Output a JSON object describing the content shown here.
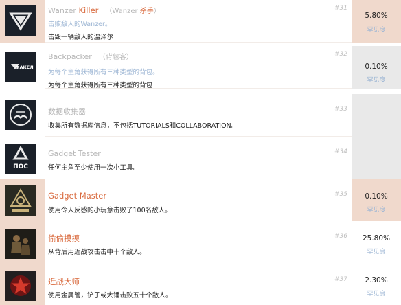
{
  "achievements": [
    {
      "title_en_prefix": "Wanzer ",
      "title_en_highlight": "Killer",
      "subtitle_prefix": "（Wanzer ",
      "subtitle_highlight": "杀手",
      "subtitle_suffix": "）",
      "hint": "击败敌人的Wanzer。",
      "description": "击毁一辆敌人的温泽尔",
      "number": "#31",
      "percent": "5.80%",
      "rarity": "罕见度",
      "icon": "triangle-emblem-icon"
    },
    {
      "title": "Backpacker",
      "subtitle": "（背包客）",
      "hint": "为每个主角获得所有三种类型的背包。",
      "description": "为每个主角获得所有三种类型的背包",
      "number": "#32",
      "percent": "0.10%",
      "rarity": "罕见度",
      "icon": "fakel-logo-icon",
      "icon_text": "ФАКЕЛ"
    },
    {
      "title": "数据收集器",
      "description": "收集所有数据库信息，不包括TUTORIALS和COLLABORATION。",
      "number": "#33",
      "icon": "book-emblem-icon"
    },
    {
      "title": "Gadget Tester",
      "description": "任何主角至少使用一次小工具。",
      "number": "#34",
      "icon": "noc-logo-icon",
      "icon_text": "ПОС"
    },
    {
      "title": "Gadget Master",
      "description": "使用令人反感的小玩意击败了100名敌人。",
      "number": "#35",
      "percent": "0.10%",
      "rarity": "罕见度",
      "icon": "hex-emblem-icon"
    },
    {
      "title": "偷偷摸摸",
      "description": "从背后用近战攻击击中十个敌人。",
      "number": "#36",
      "percent": "25.80%",
      "rarity": "罕见度",
      "icon": "soldier-icon"
    },
    {
      "title": "近战大师",
      "description": "使用金属管，铲子或大锤击败五十个敌人。",
      "number": "#37",
      "percent": "2.30%",
      "rarity": "罕见度",
      "icon": "red-star-icon"
    }
  ]
}
